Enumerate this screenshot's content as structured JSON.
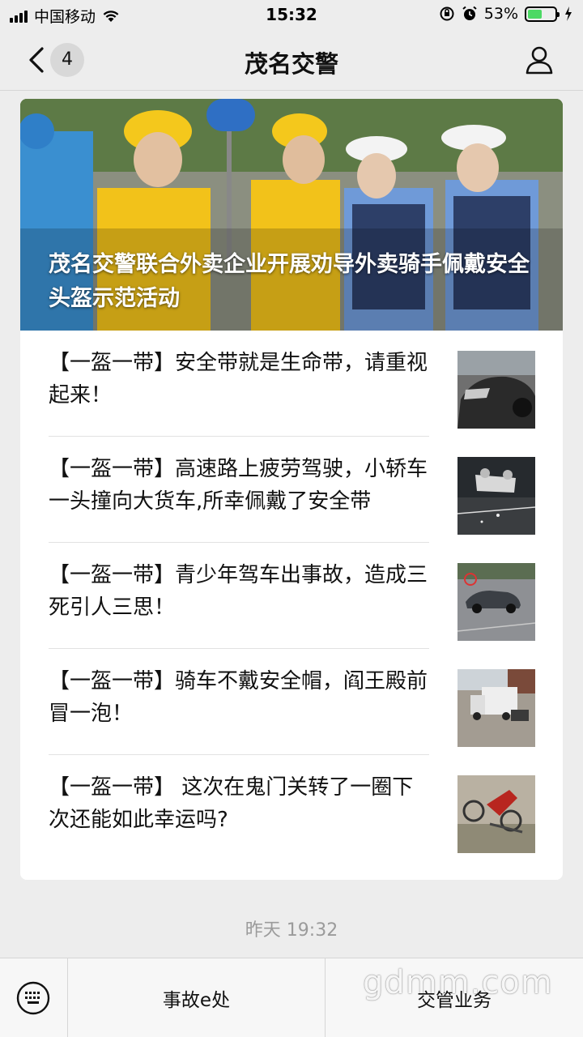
{
  "status_bar": {
    "carrier": "中国移动",
    "time": "15:32",
    "battery": "53%",
    "battery_level": 0.53,
    "icons": [
      "signal-icon",
      "wifi-icon",
      "orientation-lock-icon",
      "alarm-icon",
      "battery-icon",
      "charging-icon"
    ]
  },
  "nav": {
    "title": "茂名交警",
    "unread_count": "4",
    "icons": [
      "chevron-left-icon",
      "profile-icon"
    ]
  },
  "article": {
    "cover_title": "茂名交警联合外卖企业开展劝导外卖骑手佩戴安全头盔示范活动",
    "items": [
      {
        "title": "【一盔一带】安全带就是生命带，请重视起来！"
      },
      {
        "title": "【一盔一带】高速路上疲劳驾驶，小轿车一头撞向大货车,所幸佩戴了安全带"
      },
      {
        "title": "【一盔一带】青少年驾车出事故，造成三死引人三思！"
      },
      {
        "title": "【一盔一带】骑车不戴安全帽，阎王殿前冒一泡！"
      },
      {
        "title": "【一盔一带】 这次在鬼门关转了一圈下次还能如此幸运吗?"
      }
    ]
  },
  "timestamp": "昨天 19:32",
  "bottom_menu": {
    "keyboard_icon": "keyboard-icon",
    "items": [
      {
        "label": "事故e处"
      },
      {
        "label": "交管业务"
      }
    ]
  },
  "watermark": "gdmm.com",
  "colors": {
    "background": "#ededed",
    "battery_fill": "#4cd964",
    "text": "#111111",
    "timestamp": "#9b9b9b"
  }
}
